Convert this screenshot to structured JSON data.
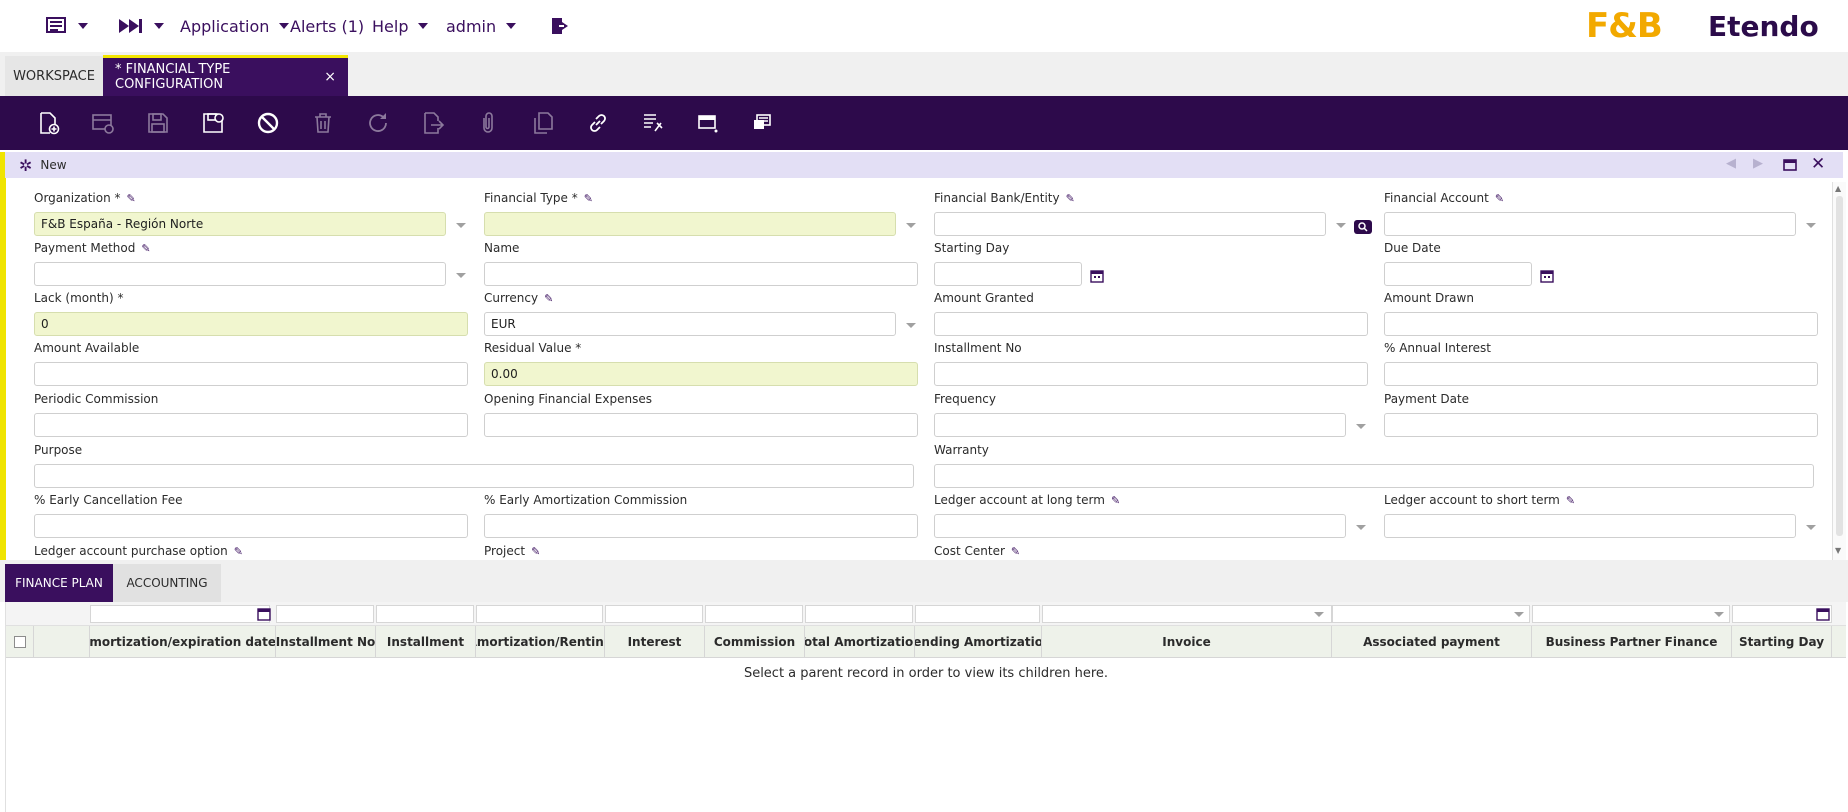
{
  "topbar": {
    "menu_icon": "list-menu-icon",
    "quicklaunch_icon": "fast-forward-icon",
    "application_label": "Application",
    "alerts_label": "Alerts (1)",
    "help_label": "Help",
    "user_label": "admin",
    "logout_icon": "logout-icon",
    "logo_fb": "F&B",
    "logo_etendo": "Etendo"
  },
  "tabs": {
    "workspace": "WORKSPACE",
    "active": "* FINANCIAL TYPE CONFIGURATION",
    "close": "×"
  },
  "toolbar": {
    "buttons": [
      "new-document-icon",
      "new-row-icon",
      "save-icon",
      "save-close-icon",
      "undo-icon",
      "delete-icon",
      "refresh-icon",
      "export-icon",
      "attachment-icon",
      "clone-icon",
      "link-icon",
      "audit-icon",
      "grid-view-icon",
      "print-icon"
    ]
  },
  "status": {
    "mode": "New"
  },
  "form": {
    "organization": {
      "label": "Organization *",
      "value": "F&B España - Región Norte"
    },
    "financial_type": {
      "label": "Financial Type *",
      "value": ""
    },
    "financial_bank": {
      "label": "Financial Bank/Entity",
      "value": ""
    },
    "financial_account": {
      "label": "Financial Account",
      "value": ""
    },
    "payment_method": {
      "label": "Payment Method",
      "value": ""
    },
    "name": {
      "label": "Name",
      "value": ""
    },
    "starting_day": {
      "label": "Starting Day",
      "value": ""
    },
    "due_date": {
      "label": "Due Date",
      "value": ""
    },
    "lack_month": {
      "label": "Lack (month) *",
      "value": "0"
    },
    "currency": {
      "label": "Currency",
      "value": "EUR"
    },
    "amount_granted": {
      "label": "Amount Granted",
      "value": ""
    },
    "amount_drawn": {
      "label": "Amount Drawn",
      "value": ""
    },
    "amount_available": {
      "label": "Amount Available",
      "value": ""
    },
    "residual_value": {
      "label": "Residual Value *",
      "value": "0.00"
    },
    "installment_no": {
      "label": "Installment No",
      "value": ""
    },
    "annual_interest": {
      "label": "% Annual Interest",
      "value": ""
    },
    "periodic_commission": {
      "label": "Periodic Commission",
      "value": ""
    },
    "opening_expenses": {
      "label": "Opening Financial Expenses",
      "value": ""
    },
    "frequency": {
      "label": "Frequency",
      "value": ""
    },
    "payment_date": {
      "label": "Payment Date",
      "value": ""
    },
    "purpose": {
      "label": "Purpose",
      "value": ""
    },
    "warranty": {
      "label": "Warranty",
      "value": ""
    },
    "early_cancel_fee": {
      "label": "% Early Cancellation Fee",
      "value": ""
    },
    "early_amort_commission": {
      "label": "% Early Amortization Commission",
      "value": ""
    },
    "ledger_long": {
      "label": "Ledger account at long term",
      "value": ""
    },
    "ledger_short": {
      "label": "Ledger account to short term",
      "value": ""
    },
    "ledger_purchase": {
      "label": "Ledger account purchase option",
      "value": ""
    },
    "project": {
      "label": "Project",
      "value": ""
    },
    "cost_center": {
      "label": "Cost Center",
      "value": ""
    }
  },
  "subtabs": {
    "finance_plan": "FINANCE PLAN",
    "accounting": "ACCOUNTING"
  },
  "grid": {
    "columns": [
      "Amortization/expiration date",
      "Installment No",
      "Installment",
      "Amortization/Renting",
      "Interest",
      "Commission",
      "Total Amortization",
      "Pending Amortization",
      "Invoice",
      "Associated payment",
      "Business Partner Finance",
      "Starting Day"
    ],
    "sort_indicator": "▲",
    "empty_message": "Select a parent record in order to view its children here."
  },
  "colors": {
    "brand_purple": "#2d0a4b",
    "accent_yellow": "#f0e400",
    "required_bg": "#f1f6cf"
  }
}
